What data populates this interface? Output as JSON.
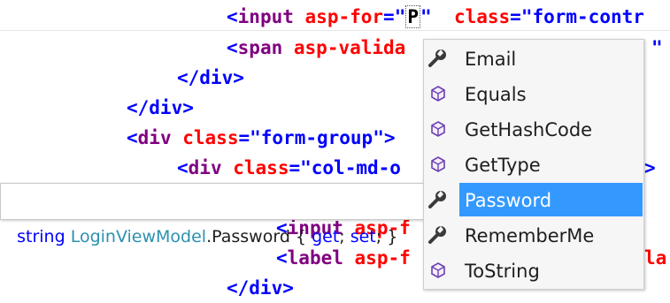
{
  "editor": {
    "line1": {
      "lt": "<",
      "tag": "input",
      "attr1": "asp-for",
      "eq1": "=\"",
      "cursorval": "P",
      "q1": "\"",
      "attr2": "class",
      "eq2": "=\"",
      "val2": "form-contr"
    },
    "line2": {
      "lt": "<",
      "tag": "span",
      "attr1": "asp-valida",
      "tail": "\""
    },
    "line3": {
      "text": "</div>"
    },
    "line4": {
      "text": "</div>"
    },
    "line5": {
      "lt": "<",
      "tag": "div",
      "attr": "class",
      "eq": "=\"",
      "val": "form-group",
      "end": "\">"
    },
    "line6": {
      "lt": "<",
      "tag": "div",
      "attr": "class",
      "eq": "=\"",
      "val": "col-md-o",
      "end": ">"
    },
    "line7": {
      "lt": "<",
      "tag": "input",
      "attr": "asp-f"
    },
    "line8": {
      "lt": "<",
      "tag": "label",
      "attr": "asp-f",
      "tail": "la"
    },
    "line9": {
      "text": "</div>"
    }
  },
  "tooltip": {
    "type_kw": "string",
    "class_name": "LoginViewModel",
    "member": ".Password { ",
    "get": "get",
    "sep": "; ",
    "set": "set",
    "end": "; }"
  },
  "completion": {
    "items": [
      {
        "label": "Email",
        "icon": "wrench-icon",
        "selected": false
      },
      {
        "label": "Equals",
        "icon": "method-cube-icon",
        "selected": false
      },
      {
        "label": "GetHashCode",
        "icon": "method-cube-icon",
        "selected": false
      },
      {
        "label": "GetType",
        "icon": "method-cube-icon",
        "selected": false
      },
      {
        "label": "Password",
        "icon": "wrench-icon",
        "selected": true
      },
      {
        "label": "RememberMe",
        "icon": "wrench-icon",
        "selected": false
      },
      {
        "label": "ToString",
        "icon": "method-cube-icon",
        "selected": false
      }
    ]
  },
  "colors": {
    "selection": "#3399ff",
    "tag": "#800000",
    "keyword": "#800080",
    "attribute": "#ff0000",
    "value": "#0000ff",
    "type": "#2b91af"
  }
}
